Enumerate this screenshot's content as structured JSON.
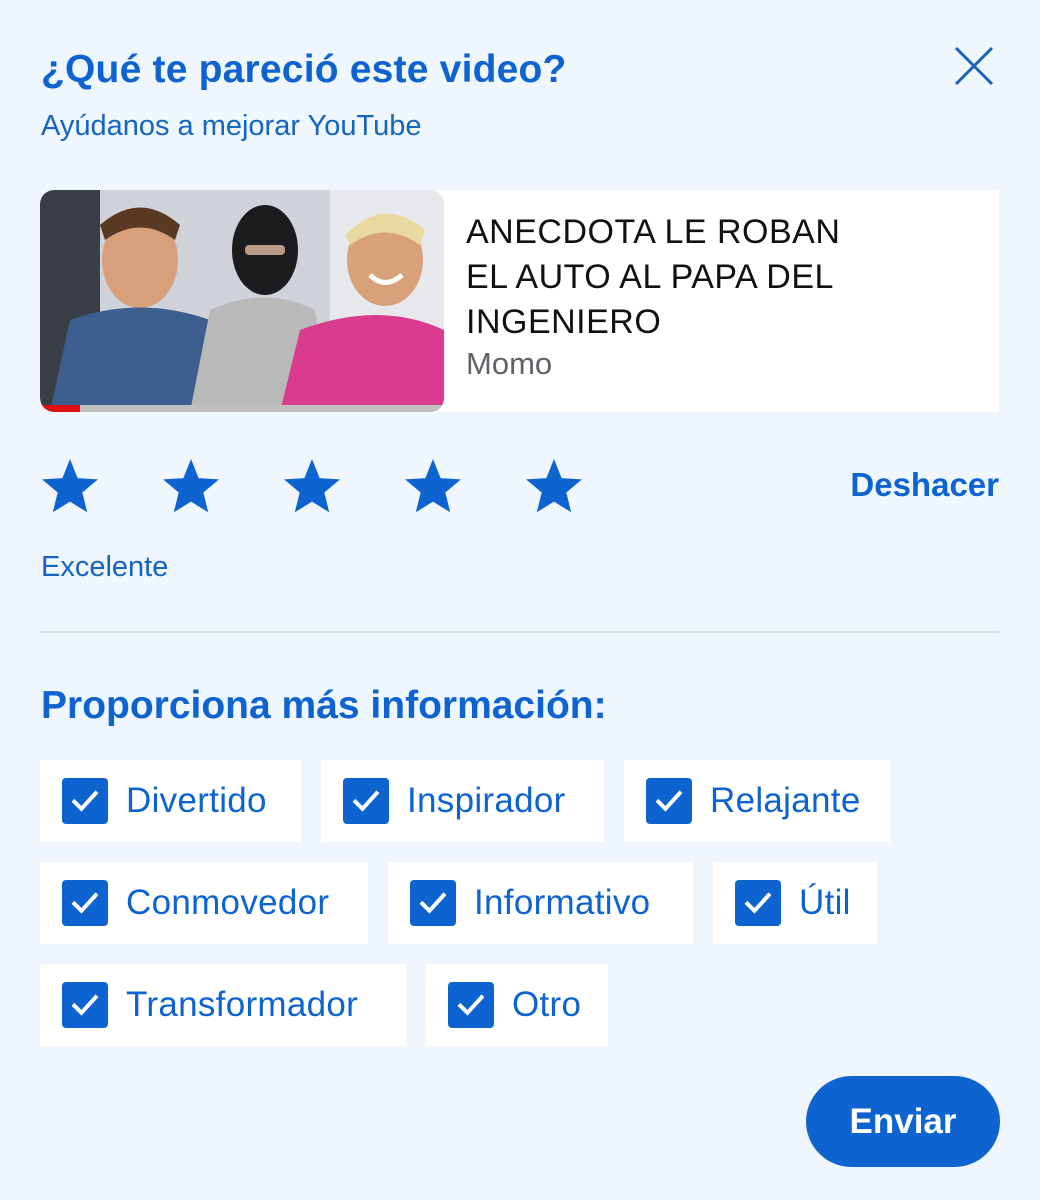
{
  "header": {
    "title": "¿Qué te pareció este video?",
    "subtitle": "Ayúdanos a mejorar YouTube",
    "close_icon": "close-icon"
  },
  "video": {
    "title": "ANECDOTA LE ROBAN EL AUTO AL PAPA DEL INGENIERO",
    "channel": "Momo",
    "watch_progress": 0.1
  },
  "rating": {
    "value": 5,
    "max": 5,
    "label": "Excelente",
    "undo_label": "Deshacer",
    "icon": "star-icon",
    "star_color": "#0d63cf"
  },
  "more_info": {
    "heading": "Proporciona más información:",
    "options": [
      {
        "label": "Divertido",
        "checked": true
      },
      {
        "label": "Inspirador",
        "checked": true
      },
      {
        "label": "Relajante",
        "checked": true
      },
      {
        "label": "Conmovedor",
        "checked": true
      },
      {
        "label": "Informativo",
        "checked": true
      },
      {
        "label": "Útil",
        "checked": true
      },
      {
        "label": "Transformador",
        "checked": true
      },
      {
        "label": "Otro",
        "checked": true
      }
    ]
  },
  "actions": {
    "send_label": "Enviar"
  },
  "colors": {
    "accent": "#0d63cf",
    "background": "#eff6fd"
  }
}
